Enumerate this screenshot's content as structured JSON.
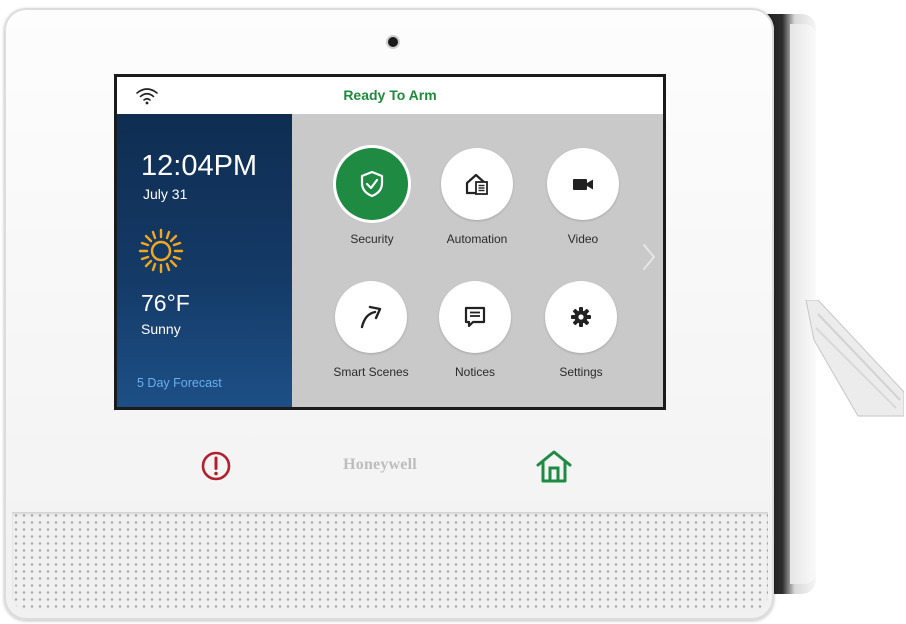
{
  "status_bar": {
    "title": "Ready To Arm",
    "wifi_icon": "wifi-icon"
  },
  "weather_panel": {
    "time": "12:04PM",
    "date": "July 31",
    "weather_icon": "sun-icon",
    "temperature": "76°F",
    "condition": "Sunny",
    "forecast_link": "5 Day Forecast"
  },
  "menu": {
    "tiles": [
      {
        "label": "Security",
        "icon": "shield-check-icon",
        "highlighted": true
      },
      {
        "label": "Automation",
        "icon": "home-automation-icon"
      },
      {
        "label": "Video",
        "icon": "video-camera-icon"
      },
      {
        "label": "Smart Scenes",
        "icon": "arrow-up-right-icon"
      },
      {
        "label": "Notices",
        "icon": "message-icon"
      },
      {
        "label": "Settings",
        "icon": "gear-icon"
      }
    ],
    "next_icon": "chevron-right-icon"
  },
  "hardware": {
    "panic_icon": "alert-icon",
    "brand": "Honeywell",
    "home_icon": "home-icon"
  },
  "colors": {
    "accent_green": "#1e8a42",
    "panic_red": "#b21f2d",
    "forecast_blue": "#67b0ee",
    "panel_navy": "#143a66"
  }
}
